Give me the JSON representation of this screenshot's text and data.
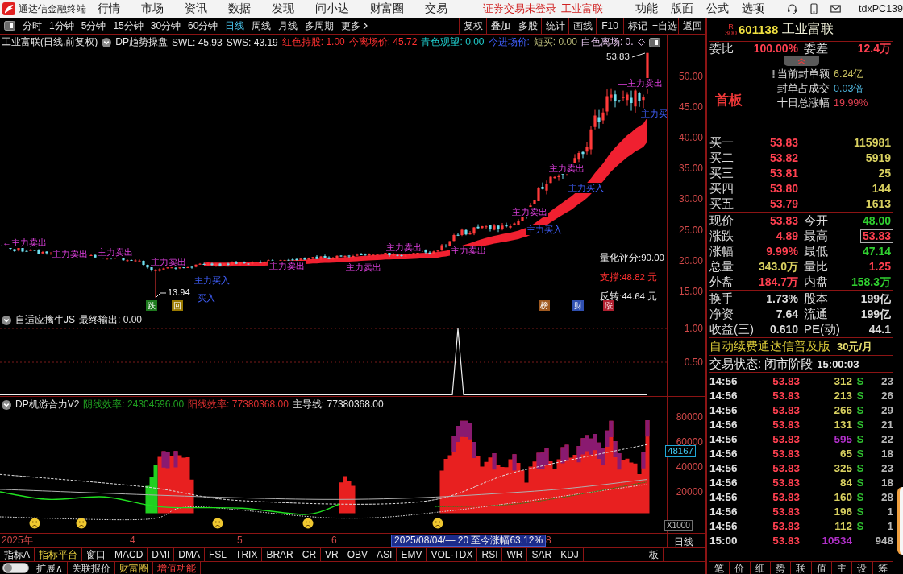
{
  "title_bar": {
    "app_name": "通达信金融终端",
    "menus": [
      "行情",
      "市场",
      "资讯",
      "数据",
      "发现",
      "问小达",
      "财富圈",
      "交易"
    ],
    "notices": [
      "证券交易未登录",
      "工业富联"
    ],
    "actions": [
      "功能",
      "版面",
      "公式",
      "选项"
    ],
    "user": "tdxPC139"
  },
  "toolbar": {
    "periods": [
      {
        "label": "分时",
        "selected": false
      },
      {
        "label": "1分钟",
        "selected": false
      },
      {
        "label": "5分钟",
        "selected": false
      },
      {
        "label": "15分钟",
        "selected": false
      },
      {
        "label": "30分钟",
        "selected": false
      },
      {
        "label": "60分钟",
        "selected": false
      },
      {
        "label": "日线",
        "selected": true
      },
      {
        "label": "周线",
        "selected": false
      },
      {
        "label": "月线",
        "selected": false
      },
      {
        "label": "多周期",
        "selected": false
      }
    ],
    "more": "更多",
    "tools": [
      "复权",
      "叠加",
      "多股",
      "统计",
      "画线",
      "F10",
      "标记",
      "+自选",
      "返回"
    ]
  },
  "price_panel": {
    "title": "工业富联(日线,前复权)",
    "indicator": "DP趋势操盘",
    "readouts": [
      {
        "text": "SWL: 45.93",
        "kind": "neutral"
      },
      {
        "text": "SWS: 43.19",
        "kind": "neutral"
      },
      {
        "text": "红色持股: 1.00",
        "kind": "hold"
      },
      {
        "text": "今离场价: 45.72",
        "kind": "hold"
      },
      {
        "text": "青色观望: 0.00",
        "kind": "watch"
      },
      {
        "text": "今进场价:",
        "kind": "entry"
      },
      {
        "text": "短买: 0.00",
        "kind": "short"
      },
      {
        "text": "白色离场: 0.",
        "kind": "exit"
      }
    ],
    "signals": [
      {
        "text": "←主力卖出",
        "kind": "sell"
      },
      {
        "text": "主力卖出",
        "kind": "sell"
      },
      {
        "text": "主力卖出",
        "kind": "sell"
      },
      {
        "text": "主力卖出",
        "kind": "sell"
      },
      {
        "text": "主力买入",
        "kind": "buy"
      },
      {
        "text": "买入",
        "kind": "buy"
      },
      {
        "text": "主力卖出",
        "kind": "sell"
      },
      {
        "text": "主力卖出",
        "kind": "sell"
      },
      {
        "text": "主力卖出",
        "kind": "sell"
      },
      {
        "text": "主力卖出",
        "kind": "sell"
      },
      {
        "text": "主力卖出",
        "kind": "sell"
      },
      {
        "text": "主力买入",
        "kind": "buy"
      },
      {
        "text": "主力卖出",
        "kind": "sell"
      },
      {
        "text": "主力买入",
        "kind": "buy"
      },
      {
        "text": "—主力卖出",
        "kind": "sell"
      },
      {
        "text": "主力买",
        "kind": "buy"
      }
    ],
    "low_label": "13.94",
    "high_label": "53.83",
    "scores": [
      {
        "text": "量化评分:90.00",
        "color": "#f0f0f0"
      },
      {
        "text": "支撑:48.82 元",
        "color": "#ff3030"
      },
      {
        "text": "反转:44.64 元",
        "color": "#f0f0f0"
      }
    ],
    "events": [
      {
        "text": "跌",
        "color": "#1e7a1e"
      },
      {
        "text": "回",
        "color": "#9a7a00"
      },
      {
        "text": "榜",
        "color": "#a05a20"
      },
      {
        "text": "财",
        "color": "#3050b0"
      },
      {
        "text": "涨",
        "color": "#b02030"
      }
    ],
    "axis": [
      "50.00",
      "45.00",
      "40.00",
      "35.00",
      "30.00",
      "25.00",
      "20.00",
      "15.00"
    ]
  },
  "signal_panel": {
    "title": "自适应擒牛JS",
    "readout": "最终输出: 0.00",
    "axis": [
      "1.00",
      "0.50"
    ]
  },
  "force_panel": {
    "title": "DP机游合力V2",
    "readouts": [
      {
        "text": "阴线效率: 24304596.00",
        "color": "#20a020"
      },
      {
        "text": "阳线效率: 77380368.00",
        "color": "#e03030"
      },
      {
        "text": "主导线: 77380368.00",
        "color": "#e6e6e6"
      }
    ],
    "axis": [
      "80000",
      "60000",
      "40000",
      "20000"
    ],
    "current": "48167",
    "scale": "X1000"
  },
  "date_axis": {
    "labels": [
      "2025年",
      "4",
      "5",
      "6",
      "8"
    ],
    "range": "2025/08/04/— 20 至今涨幅63.12%",
    "period": "日线"
  },
  "indicator_tabs": [
    {
      "label": "指标A",
      "selected": false
    },
    {
      "label": "指标平台",
      "selected": true
    },
    {
      "label": "窗口",
      "selected": false
    },
    {
      "label": "MACD",
      "selected": false
    },
    {
      "label": "DMI",
      "selected": false
    },
    {
      "label": "DMA",
      "selected": false
    },
    {
      "label": "FSL",
      "selected": false
    },
    {
      "label": "TRIX",
      "selected": false
    },
    {
      "label": "BRAR",
      "selected": false
    },
    {
      "label": "CR",
      "selected": false
    },
    {
      "label": "VR",
      "selected": false
    },
    {
      "label": "OBV",
      "selected": false
    },
    {
      "label": "ASI",
      "selected": false
    },
    {
      "label": "EMV",
      "selected": false
    },
    {
      "label": "VOL-TDX",
      "selected": false
    },
    {
      "label": "RSI",
      "selected": false
    },
    {
      "label": "WR",
      "selected": false
    },
    {
      "label": "SAR",
      "selected": false
    },
    {
      "label": "KDJ",
      "selected": false
    },
    {
      "label": "板",
      "selected": false
    }
  ],
  "bottom_bar": {
    "toggle": {
      "on": false
    },
    "links": [
      {
        "label": "扩展∧",
        "kind": "plain"
      },
      {
        "label": "关联报价",
        "kind": "plain"
      },
      {
        "label": "财富圈",
        "kind": "featured"
      },
      {
        "label": "增值功能",
        "kind": "promo"
      }
    ]
  },
  "quote_panel": {
    "badge": [
      "R",
      "300"
    ],
    "code": "601138",
    "name": "工业富联",
    "ratio": [
      {
        "label": "委比",
        "value": "100.00%"
      },
      {
        "label": "委差",
        "value": "12.4万"
      }
    ],
    "limit": {
      "tag": "首板",
      "lines": [
        {
          "label": "当前封单额",
          "value": "6.24亿",
          "color": "#c8c060"
        },
        {
          "label": "封单占成交",
          "value": "0.03倍",
          "color": "#50b8e0"
        },
        {
          "label": "十日总涨幅",
          "value": "19.99%",
          "color": "#e04050"
        }
      ]
    },
    "bids": [
      {
        "label": "买一",
        "price": "53.83",
        "volume": "115981"
      },
      {
        "label": "买二",
        "price": "53.82",
        "volume": "5919"
      },
      {
        "label": "买三",
        "price": "53.81",
        "volume": "25"
      },
      {
        "label": "买四",
        "price": "53.80",
        "volume": "144"
      },
      {
        "label": "买五",
        "price": "53.79",
        "volume": "1613"
      }
    ],
    "stats": [
      {
        "label": "现价",
        "value": "53.83",
        "color": "#ff4050",
        "outlined": false
      },
      {
        "label": "今开",
        "value": "48.00",
        "color": "#30d030",
        "outlined": false
      },
      {
        "label": "涨跌",
        "value": "4.89",
        "color": "#ff4050",
        "outlined": false
      },
      {
        "label": "最高",
        "value": "53.83",
        "color": "#ff4050",
        "outlined": true
      },
      {
        "label": "涨幅",
        "value": "9.99%",
        "color": "#ff4050",
        "outlined": false
      },
      {
        "label": "最低",
        "value": "47.14",
        "color": "#30d030",
        "outlined": false
      },
      {
        "label": "总量",
        "value": "343.0万",
        "color": "#d8d060",
        "outlined": false
      },
      {
        "label": "量比",
        "value": "1.25",
        "color": "#ff4050",
        "outlined": false
      },
      {
        "label": "外盘",
        "value": "184.7万",
        "color": "#ff4050",
        "outlined": false
      },
      {
        "label": "内盘",
        "value": "158.3万",
        "color": "#30d030",
        "outlined": false
      }
    ],
    "fundamentals": [
      {
        "label": "换手",
        "value": "1.73%"
      },
      {
        "label": "股本",
        "value": "199亿"
      },
      {
        "label": "净资",
        "value": "7.64"
      },
      {
        "label": "流通",
        "value": "199亿"
      },
      {
        "label": "收益(三)",
        "value": "0.610"
      },
      {
        "label": "PE(动)",
        "value": "44.1"
      }
    ],
    "promo": {
      "text": "自动续费通达信普及版",
      "price": "30元/月"
    },
    "status": {
      "text": "交易状态: 闭市阶段",
      "time": "15:00:03"
    },
    "ticks": [
      {
        "time": "14:56",
        "price": "53.83",
        "volume": "312",
        "side": "S",
        "count": "23",
        "large": false
      },
      {
        "time": "14:56",
        "price": "53.83",
        "volume": "213",
        "side": "S",
        "count": "26",
        "large": false
      },
      {
        "time": "14:56",
        "price": "53.83",
        "volume": "266",
        "side": "S",
        "count": "29",
        "large": false
      },
      {
        "time": "14:56",
        "price": "53.83",
        "volume": "131",
        "side": "S",
        "count": "21",
        "large": false
      },
      {
        "time": "14:56",
        "price": "53.83",
        "volume": "595",
        "side": "S",
        "count": "22",
        "large": true
      },
      {
        "time": "14:56",
        "price": "53.83",
        "volume": "65",
        "side": "S",
        "count": "18",
        "large": false
      },
      {
        "time": "14:56",
        "price": "53.83",
        "volume": "325",
        "side": "S",
        "count": "23",
        "large": false
      },
      {
        "time": "14:56",
        "price": "53.83",
        "volume": "84",
        "side": "S",
        "count": "18",
        "large": false
      },
      {
        "time": "14:56",
        "price": "53.83",
        "volume": "160",
        "side": "S",
        "count": "28",
        "large": false
      },
      {
        "time": "14:56",
        "price": "53.83",
        "volume": "196",
        "side": "S",
        "count": "1",
        "large": false
      },
      {
        "time": "14:56",
        "price": "53.83",
        "volume": "112",
        "side": "S",
        "count": "1",
        "large": false
      },
      {
        "time": "15:00",
        "price": "53.83",
        "volume": "10534",
        "count": "948",
        "large": true
      }
    ],
    "tabs": [
      "笔",
      "价",
      "细",
      "势",
      "联",
      "值",
      "主",
      "设",
      "筹"
    ]
  }
}
